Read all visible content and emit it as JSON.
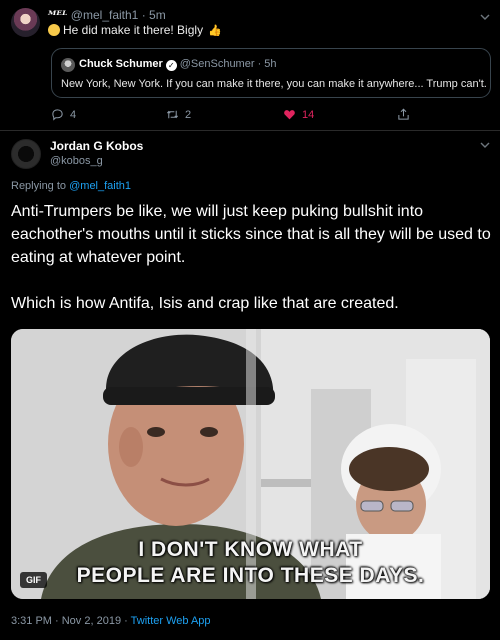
{
  "parent_tweet": {
    "display_name": "ᴹᴱᴸ",
    "handle": "@mel_faith1",
    "time": "· 5m",
    "text": "He did make it there! Bigly",
    "quoted": {
      "name": "Chuck Schumer",
      "handle": "@SenSchumer",
      "time": "· 5h",
      "text": "New York, New York. If you can make it there, you can make it anywhere... Trump can't."
    },
    "actions": {
      "replies": "4",
      "retweets": "2",
      "likes": "14"
    },
    "colors": {
      "like": "#e0245e"
    }
  },
  "main_tweet": {
    "display_name": "Jordan G Kobos",
    "handle": "@kobos_g",
    "replying_prefix": "Replying to",
    "replying_to": "@mel_faith1",
    "paragraph1": "Anti-Trumpers be like, we will just keep puking bullshit into eachother's mouths until it sticks since that is all they will be used to eating at whatever point.",
    "paragraph2": "Which is how Antifa, Isis and crap like that are created.",
    "media": {
      "caption_line1": "I DON'T KNOW WHAT",
      "caption_line2": "PEOPLE ARE INTO THESE DAYS.",
      "badge": "GIF"
    },
    "timestamp": "3:31 PM · Nov 2, 2019",
    "separator": "·",
    "source": "Twitter Web App"
  },
  "colors": {
    "link": "#1da1f2",
    "background": "#000000",
    "border": "#38444d"
  }
}
